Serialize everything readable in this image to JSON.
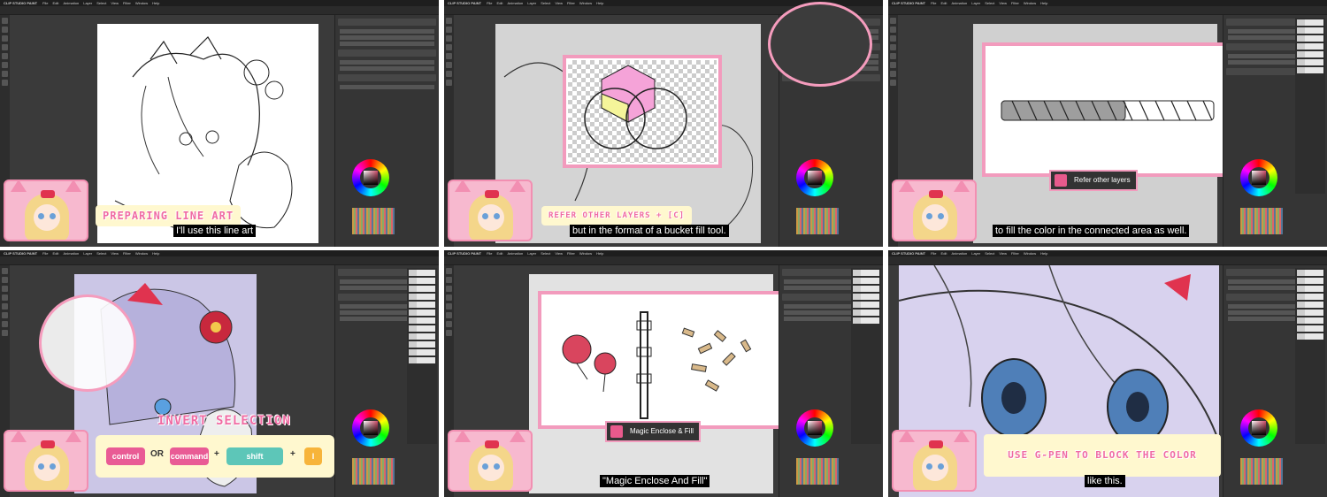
{
  "app": {
    "name": "CLIP STUDIO PAINT",
    "menus": [
      "File",
      "Edit",
      "Animation",
      "Layer",
      "Select",
      "View",
      "Filter",
      "Window",
      "Help"
    ]
  },
  "panels": [
    {
      "banner": "PREPARING LINE ART",
      "subtitle": "I'll use this line art"
    },
    {
      "banner": "REFER OTHER LAYERS + [C]",
      "subtitle": "but in the format of a bucket fill tool."
    },
    {
      "callout_label": "Refer other layers",
      "subtitle": "to fill the color in the connected area as well."
    },
    {
      "banner": "INVERT SELECTION",
      "keys": {
        "k1": "control",
        "or": "OR",
        "k2": "command",
        "plus1": "+",
        "k3": "shift",
        "plus2": "+",
        "k4": "I"
      }
    },
    {
      "callout_label": "Magic Enclose & Fill",
      "subtitle": "\"Magic Enclose And Fill\""
    },
    {
      "banner": "USE G-PEN TO BLOCK THE COLOR",
      "subtitle": "like this."
    }
  ],
  "colors": {
    "accent_pink": "#f29bbd",
    "banner_bg": "#fff8cf",
    "banner_text": "#f06ba3",
    "key_pink": "#e95b95",
    "key_teal": "#5dc6b8",
    "key_orange": "#f7b43a"
  }
}
